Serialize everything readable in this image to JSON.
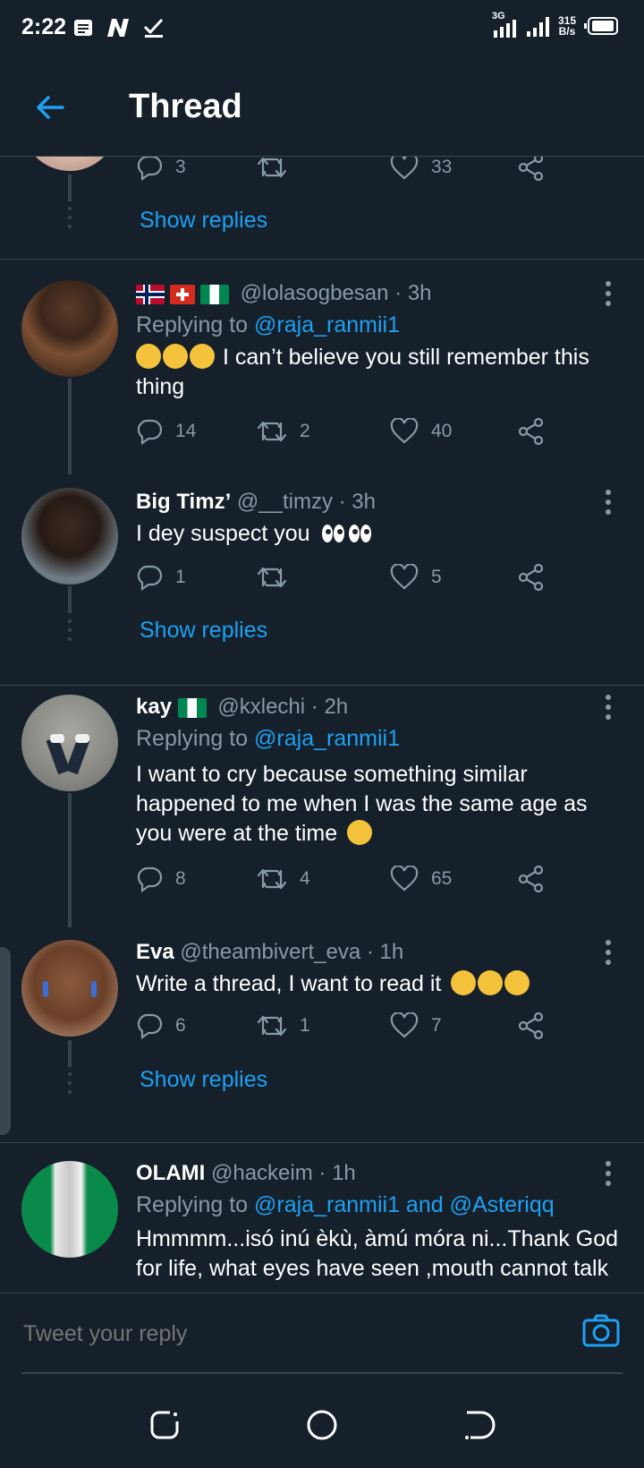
{
  "status_bar": {
    "time": "2:22",
    "network": "3G",
    "speed_value": "315",
    "speed_unit": "B/s"
  },
  "app_bar": {
    "title": "Thread"
  },
  "top_partial": {
    "reply_count": "3",
    "retweet_count": "",
    "like_count": "33",
    "show_replies": "Show replies"
  },
  "tweets": [
    {
      "name": "",
      "handle": "@lolasogbesan",
      "time": "· 3h",
      "replying_prefix": "Replying to",
      "replying_to": "@raja_ranmii1",
      "text": "I can’t believe you still remember this thing",
      "reply_count": "14",
      "retweet_count": "2",
      "like_count": "40"
    },
    {
      "name": "Big Timz’",
      "handle": "@__timzy",
      "time": "· 3h",
      "text": "I dey suspect you",
      "reply_count": "1",
      "retweet_count": "",
      "like_count": "5",
      "show_replies": "Show replies"
    },
    {
      "name": "kay",
      "handle": "@kxlechi",
      "time": "· 2h",
      "replying_prefix": "Replying to",
      "replying_to": "@raja_ranmii1",
      "text": "I want to cry because something similar happened to me when I was the same age as you were at the time",
      "reply_count": "8",
      "retweet_count": "4",
      "like_count": "65"
    },
    {
      "name": "Eva",
      "handle": "@theambivert_eva",
      "time": "· 1h",
      "text": "Write a thread, I want to read it",
      "reply_count": "6",
      "retweet_count": "1",
      "like_count": "7",
      "show_replies": "Show replies"
    },
    {
      "name": "OLAMI",
      "handle": "@hackeim",
      "time": "· 1h",
      "replying_prefix": "Replying to",
      "replying_to": "@raja_ranmii1 and @Asteriqq",
      "text": "Hmmmm...isó inú èkù, àmú móra ni...Thank God for life, what eyes have seen ,mouth cannot talk"
    }
  ],
  "reply_box": {
    "placeholder": "Tweet your reply"
  },
  "colors": {
    "background": "#15202b",
    "accent": "#1da1f2",
    "secondary_text": "#8899a6",
    "divider": "#38444d"
  },
  "icons": [
    "back-arrow-icon",
    "reply-icon",
    "retweet-icon",
    "like-icon",
    "share-icon",
    "more-icon",
    "camera-icon"
  ]
}
